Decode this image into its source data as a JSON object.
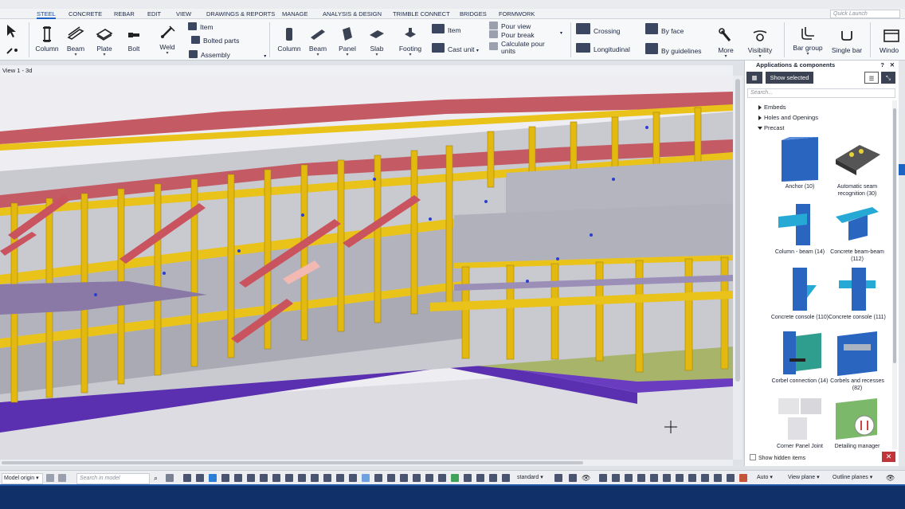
{
  "tabs": [
    "STEEL",
    "CONCRETE",
    "REBAR",
    "EDIT",
    "VIEW",
    "DRAWINGS & REPORTS",
    "MANAGE",
    "ANALYSIS & DESIGN",
    "TRIMBLE CONNECT",
    "BRIDGES",
    "FORMWORK"
  ],
  "quick_launch": "Quick Launch",
  "ribbon": {
    "steel_column": "Column",
    "steel_beam": "Beam",
    "plate": "Plate",
    "bolt": "Bolt",
    "weld": "Weld",
    "item": "Item",
    "bolted_parts": "Bolted parts",
    "assembly": "Assembly",
    "concrete_column": "Column",
    "concrete_beam": "Beam",
    "panel": "Panel",
    "slab": "Slab",
    "footing": "Footing",
    "concrete_item": "Item",
    "cast_unit": "Cast unit",
    "pour_view": "Pour view",
    "pour_break": "Pour break",
    "calculate_pour_units": "Calculate pour units",
    "crossing": "Crossing",
    "longitudinal": "Longitudinal",
    "by_face": "By face",
    "by_guidelines": "By guidelines",
    "more": "More",
    "visibility": "Visibility",
    "bar_group": "Bar group",
    "single_bar": "Single bar",
    "window": "Windo"
  },
  "view_title": "View 1 - 3d",
  "panel": {
    "title": "Applications & components",
    "show_selected": "Show selected",
    "search_placeholder": "Search...",
    "tree": [
      "Embeds",
      "Holes and Openings",
      "Precast"
    ],
    "components": [
      {
        "name": "Anchor (10)"
      },
      {
        "name": "Automatic seam recognition (30)"
      },
      {
        "name": "Column - beam (14)"
      },
      {
        "name": "Concrete beam-beam (112)"
      },
      {
        "name": "Concrete console (110)"
      },
      {
        "name": "Concrete console (111)"
      },
      {
        "name": "Corbel connection (14)"
      },
      {
        "name": "Corbels and recesses (82)"
      },
      {
        "name": "Corner Panel Joint"
      },
      {
        "name": "Detailing manager"
      }
    ],
    "show_hidden": "Show hidden items"
  },
  "statusbar": {
    "model_origin": "Model origin",
    "search_model": "Search in model",
    "standard": "standard",
    "auto": "Auto",
    "view_plane": "View plane",
    "outline_planes": "Outline planes"
  },
  "colors": {
    "accent": "#1c63c4",
    "steel_yellow": "#e9c21a",
    "slab_red": "#c45a64",
    "concrete_gray": "#a9aab3",
    "footing_purple": "#6a3cc0",
    "bottom_bar": "#10306a"
  }
}
